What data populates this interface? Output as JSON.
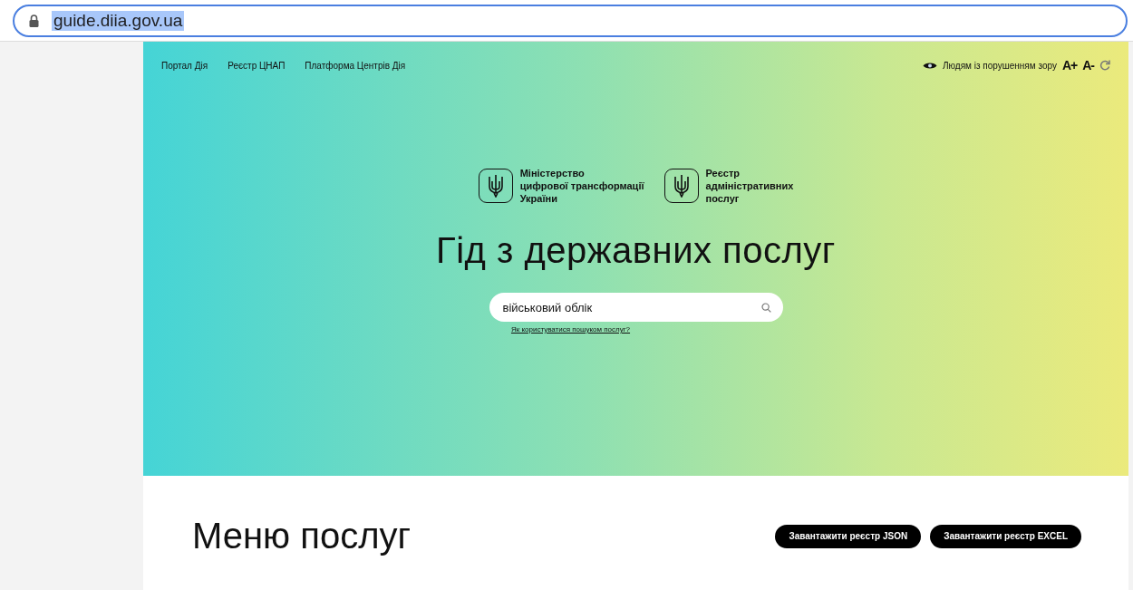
{
  "browser": {
    "address": "guide.diia.gov.ua",
    "address_selected": true
  },
  "top_nav": {
    "links": [
      "Портал Дія",
      "Реєстр ЦНАП",
      "Платформа Центрів Дія"
    ],
    "accessibility_label": "Людям із порушенням зору",
    "font_increase": "A+",
    "font_decrease": "A-"
  },
  "logos": [
    {
      "text": "Міністерство\nцифрової трансформації\nУкраїни"
    },
    {
      "text": "Реєстр\nадміністративних\nпослуг"
    }
  ],
  "hero": {
    "title": "Гід з державних послуг",
    "search": {
      "value": "військовий облік"
    },
    "help_link": "Як користуватися пошуком послуг?"
  },
  "menu_section": {
    "title": "Меню послуг",
    "buttons": [
      "Завантажити реєстр JSON",
      "Завантажити реєстр EXCEL"
    ]
  }
}
